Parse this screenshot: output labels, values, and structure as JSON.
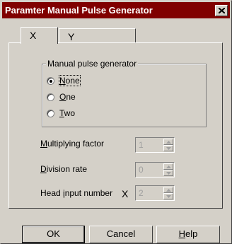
{
  "window": {
    "title": "Paramter Manual Pulse Generator"
  },
  "tabs": [
    {
      "label": "X"
    },
    {
      "label": "Y"
    }
  ],
  "groupbox": {
    "label": "Manual pulse generator",
    "options": [
      {
        "mnemonic": "N",
        "rest": "one",
        "selected": true
      },
      {
        "mnemonic": "O",
        "rest": "ne",
        "selected": false
      },
      {
        "mnemonic": "T",
        "rest": "wo",
        "selected": false
      }
    ]
  },
  "fields": {
    "multiplying": {
      "mnemonic": "M",
      "rest": "ultiplying factor",
      "value": "1"
    },
    "division": {
      "mnemonic": "D",
      "rest": "ivision rate",
      "value": "0"
    },
    "head_input": {
      "pre": "Head ",
      "mnemonic": "i",
      "rest": "nput number",
      "axis": "X",
      "value": "2"
    }
  },
  "buttons": {
    "ok": "OK",
    "cancel": "Cancel",
    "help_mnemonic": "H",
    "help_rest": "elp"
  }
}
